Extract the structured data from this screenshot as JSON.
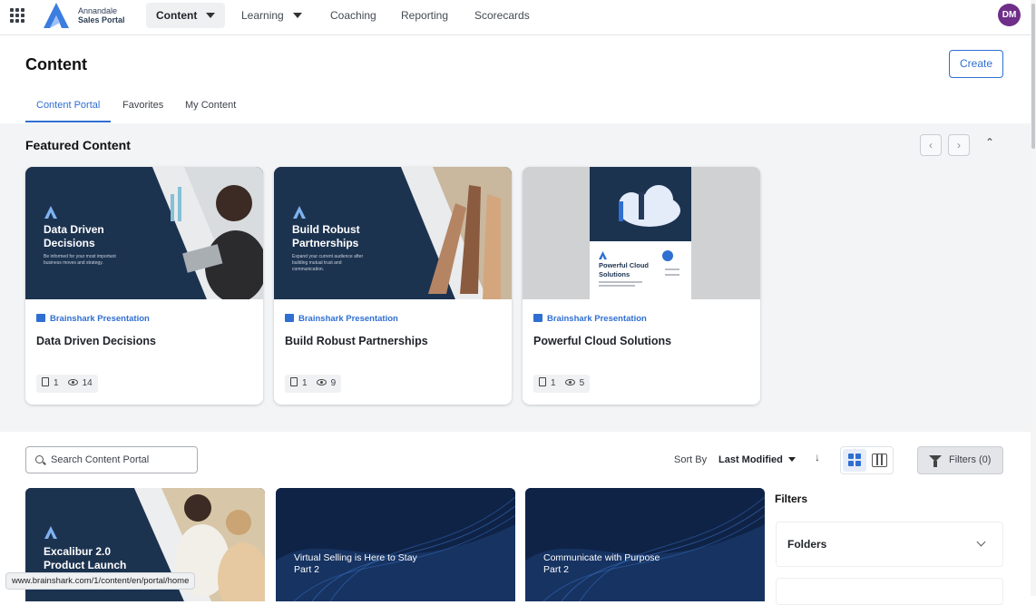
{
  "app": {
    "brand_line1": "Annandale",
    "brand_line2": "Sales Portal",
    "avatar_initials": "DM"
  },
  "nav": {
    "items": [
      {
        "label": "Content",
        "active": true,
        "dropdown": true
      },
      {
        "label": "Learning",
        "active": false,
        "dropdown": true
      },
      {
        "label": "Coaching",
        "active": false
      },
      {
        "label": "Reporting",
        "active": false
      },
      {
        "label": "Scorecards",
        "active": false
      }
    ]
  },
  "header": {
    "title": "Content",
    "create_label": "Create"
  },
  "tabs": [
    {
      "label": "Content Portal",
      "active": true
    },
    {
      "label": "Favorites"
    },
    {
      "label": "My Content"
    }
  ],
  "featured": {
    "title": "Featured Content",
    "cards": [
      {
        "type": "Brainshark Presentation",
        "name": "Data Driven Decisions",
        "thumb_title": "Data Driven\nDecisions",
        "thumb_sub": "Be informed for your most important business moves and strategy.",
        "docs": "1",
        "views": "14"
      },
      {
        "type": "Brainshark Presentation",
        "name": "Build Robust Partnerships",
        "thumb_title": "Build Robust\nPartnerships",
        "thumb_sub": "Expand your current audience after building mutual trust and communication.",
        "docs": "1",
        "views": "9"
      },
      {
        "type": "Brainshark Presentation",
        "name": "Powerful Cloud Solutions",
        "thumb_title": "Powerful Cloud\nSolutions",
        "docs": "1",
        "views": "5"
      }
    ]
  },
  "toolbar": {
    "search_placeholder": "Search Content Portal",
    "sort_label": "Sort By",
    "sort_value": "Last Modified",
    "filters_label": "Filters (0)"
  },
  "library": {
    "cards": [
      {
        "thumb_title": "Excalibur 2.0\nProduct Launch"
      },
      {
        "thumb_title": "Virtual Selling is Here to Stay\nPart 2"
      },
      {
        "thumb_title": "Communicate with Purpose\nPart 2"
      }
    ]
  },
  "filters_panel": {
    "title": "Filters",
    "sections": [
      {
        "label": "Folders"
      }
    ]
  },
  "status_url": "www.brainshark.com/1/content/en/portal/home",
  "colors": {
    "accent": "#2f6fd1",
    "thumb_navy": "#1c3350",
    "avatar": "#6f2e88"
  }
}
